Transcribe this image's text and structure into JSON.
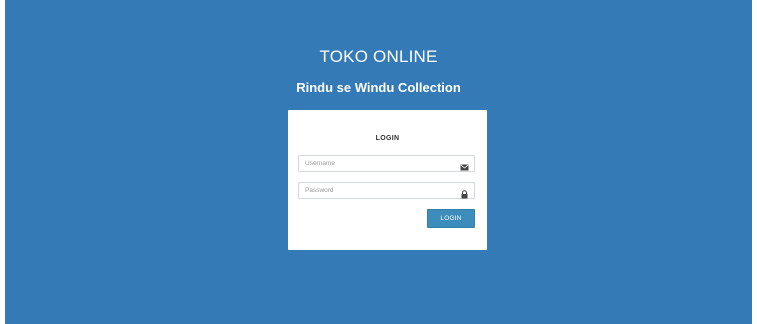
{
  "header": {
    "title": "TOKO ONLINE",
    "subtitle": "Rindu se Windu Collection"
  },
  "login_box": {
    "title": "LOGIN",
    "username": {
      "placeholder": "Username",
      "value": "",
      "icon": "envelope-icon"
    },
    "password": {
      "placeholder": "Password",
      "value": "",
      "icon": "lock-icon"
    },
    "submit_label": "LOGIN"
  },
  "colors": {
    "background": "#337ab7",
    "button": "#3c8dbc",
    "card": "#ffffff"
  }
}
